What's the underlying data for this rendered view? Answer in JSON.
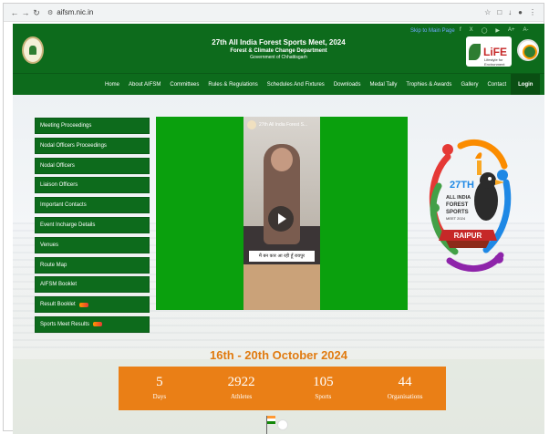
{
  "browser": {
    "url": "aifsm.nic.in",
    "back_icon": "arrow-left-icon",
    "forward_icon": "arrow-right-icon",
    "reload_icon": "reload-icon"
  },
  "header": {
    "title": "27th All India Forest Sports Meet, 2024",
    "subtitle": "Forest & Climate Change Department",
    "subtitle2": "Government of Chhattisgarh",
    "skip_link": "Skip to Main Page",
    "life_logo_text": "LiFE",
    "life_logo_sub": "Lifestyle for Environment"
  },
  "nav": {
    "items": [
      "Home",
      "About AIFSM",
      "Committees",
      "Rules & Regulations",
      "Schedules And Fixtures",
      "Downloads",
      "Medal Tally",
      "Trophies & Awards",
      "Gallery",
      "Contact",
      "Login"
    ]
  },
  "side_menu": {
    "items": [
      {
        "label": "Meeting Proceedings",
        "new": false
      },
      {
        "label": "Nodal Officers Proceedings",
        "new": false
      },
      {
        "label": "Nodal Officers",
        "new": false
      },
      {
        "label": "Liaison Officers",
        "new": false
      },
      {
        "label": "Important Contacts",
        "new": false
      },
      {
        "label": "Event Incharge Details",
        "new": false
      },
      {
        "label": "Venues",
        "new": false
      },
      {
        "label": "Route Map",
        "new": false
      },
      {
        "label": "AIFSM Booklet",
        "new": false
      },
      {
        "label": "Result Booklet",
        "new": true
      },
      {
        "label": "Sports Meet Results",
        "new": true
      }
    ]
  },
  "video": {
    "channel": "27th All India Forest S...",
    "caption": "मैं बन कार आ रही हूँ रायपुर"
  },
  "mascot": {
    "line1": "27TH",
    "line2": "ALL INDIA",
    "line3": "FOREST",
    "line4": "SPORTS",
    "line5": "MEET 2024",
    "city": "RAIPUR"
  },
  "event": {
    "dates": "16th - 20th October 2024"
  },
  "stats": [
    {
      "value": "5",
      "label": "Days"
    },
    {
      "value": "2922",
      "label": "Athletes"
    },
    {
      "value": "105",
      "label": "Sports"
    },
    {
      "value": "44",
      "label": "Organisations"
    }
  ],
  "colors": {
    "header_green": "#0d6b1c",
    "video_green": "#0aa00d",
    "stats_orange": "#ea7f16",
    "date_orange": "#e07b10"
  }
}
